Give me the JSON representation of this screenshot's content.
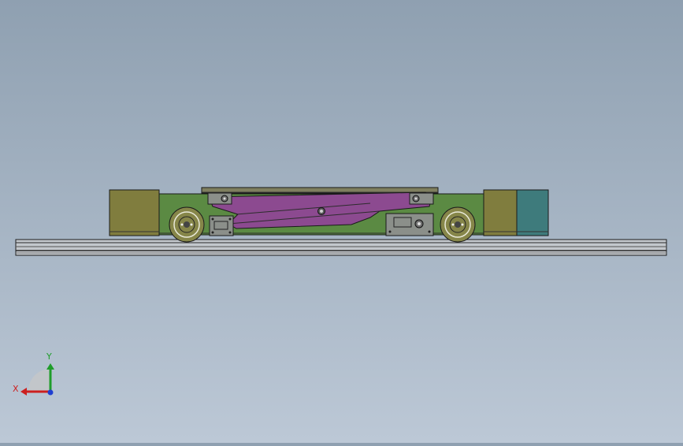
{
  "view": {
    "background_top": "#8fa0b1",
    "background_bottom": "#bcc8d6"
  },
  "model": {
    "colors": {
      "end_block": "#807d3e",
      "end_block_right_cap": "#3e7b7c",
      "chassis": "#5b8a43",
      "scissor_arm": "#8c4a90",
      "top_plate": "#7f7f5f",
      "bracket": "#8b8f8a",
      "wheel": "#868649",
      "rail": "#b9bec4"
    }
  },
  "triad": {
    "x_label": "X",
    "y_label": "Y",
    "x_color": "#cc1f1f",
    "y_color": "#1f9d2a",
    "z_color": "#1f3fd1"
  }
}
